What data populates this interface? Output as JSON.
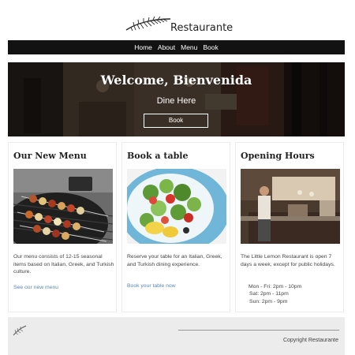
{
  "header": {
    "brand": "Restaurante"
  },
  "nav": {
    "items": [
      "Home",
      "About",
      "Menu",
      "Book"
    ]
  },
  "hero": {
    "title": "Welcome, Bienvenida",
    "subtitle": "Dine Here",
    "button_label": "Book"
  },
  "cards": [
    {
      "title": "Our New Menu",
      "text": "Our menu consists of 12-15 seasonal items based on Italian, Greek, and Turkish culture.",
      "link": "See our new menu"
    },
    {
      "title": "Book a table",
      "text": "Reserve your table for an Italian, Greek, and Turkish dining experience.",
      "link": "Book your table now"
    },
    {
      "title": "Opening Hours",
      "text": "The Little Lemon Restaurant is open 7 days a week, except for public holidays.",
      "hours": [
        "Mon - Fri: 2pm - 10pm",
        "Sat: 2pm - 11pm",
        "Sun: 2pm - 9pm"
      ]
    }
  ],
  "footer": {
    "copyright": "Copyright Restaurante"
  },
  "colors": {
    "navbar": "#121212",
    "link": "#5b87b5",
    "footer_bg": "#ececec"
  },
  "icons": {
    "logo": "feather-icon",
    "footer_logo": "feather-icon"
  }
}
